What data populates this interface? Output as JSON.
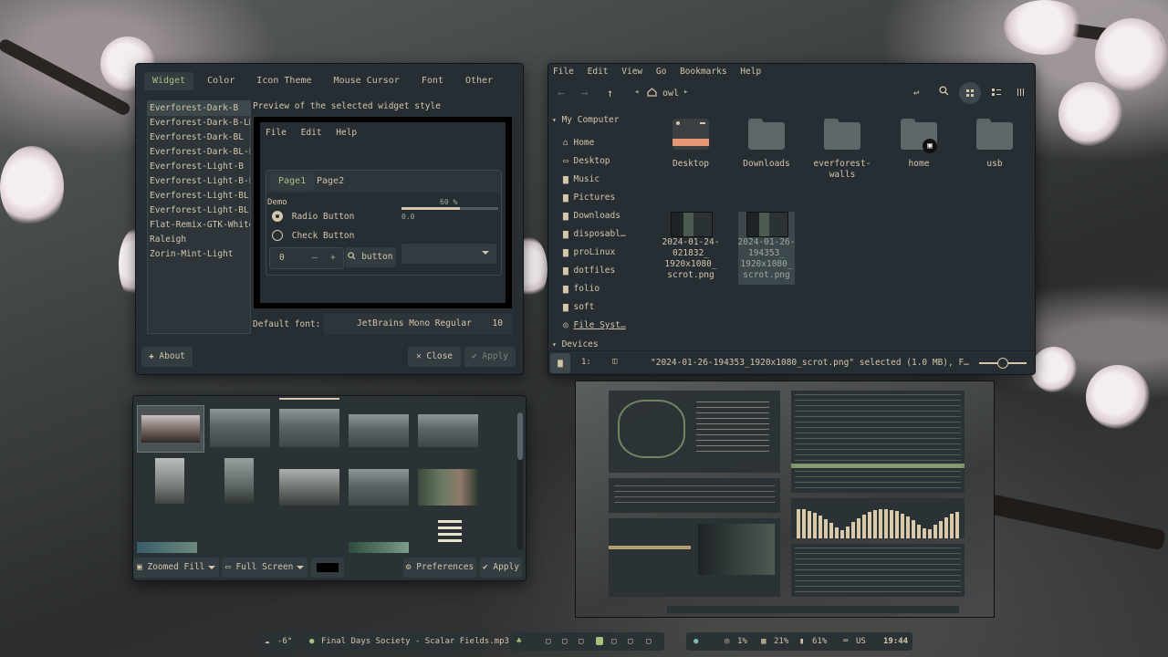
{
  "theme_window": {
    "tabs": [
      "Widget",
      "Color",
      "Icon Theme",
      "Mouse Cursor",
      "Font",
      "Other"
    ],
    "themes": [
      "Everforest-Dark-B",
      "Everforest-Dark-B-LB",
      "Everforest-Dark-BL",
      "Everforest-Dark-BL-LB",
      "Everforest-Light-B",
      "Everforest-Light-B-LB",
      "Everforest-Light-BL",
      "Everforest-Light-BL-LB",
      "Flat-Remix-GTK-White-Darkest",
      "Raleigh",
      "Zorin-Mint-Light"
    ],
    "preview_label": "Preview of the selected widget style",
    "preview_menu": [
      "File",
      "Edit",
      "Help"
    ],
    "preview_tabs": [
      "Page1",
      "Page2"
    ],
    "demo_label": "Demo",
    "radio_label": "Radio Button",
    "check_label": "Check Button",
    "progress_label": "60 %",
    "progress_value": 0.6,
    "scale_value": "0.0",
    "spin_value": "0",
    "button_label": "button",
    "default_font_label": "Default font:",
    "font_name": "JetBrains Mono Regular",
    "font_size": "10",
    "about_label": "About",
    "close_label": "Close",
    "apply_label": "Apply"
  },
  "file_manager": {
    "menu": [
      "File",
      "Edit",
      "View",
      "Go",
      "Bookmarks",
      "Help"
    ],
    "location": "owl",
    "section_my_computer": "My Computer",
    "sidebar": [
      "Home",
      "Desktop",
      "Music",
      "Pictures",
      "Downloads",
      "disposabl…",
      "proLinux",
      "dotfiles",
      "folio",
      "soft",
      "File Syst…"
    ],
    "section_devices": "Devices",
    "items_row1": [
      "Desktop",
      "Downloads",
      "everforest-walls",
      "home",
      "usb"
    ],
    "file1_label": "2024-01-24-021832_1920x1080_scrot.png",
    "file2_label": "2024-01-26-194353_1920x1080_scrot.png",
    "file1_lines": [
      "2024-01-24-",
      "021832_",
      "1920x1080_",
      "scrot.png"
    ],
    "file2_lines": [
      "2024-01-26-",
      "194353_",
      "1920x1080_",
      "scrot.png"
    ],
    "status": "\"2024-01-26-194353_1920x1080_scrot.png\" selected (1.0 MB), F…",
    "status_btn2": "1:"
  },
  "wallpaper_window": {
    "zoom_option": "Zoomed Fill",
    "screen_option": "Full Screen",
    "preferences_label": "Preferences",
    "apply_label": "Apply"
  },
  "taskbar": {
    "weather": "-6°",
    "music": "Final Days Society - Scalar Fields.mp3",
    "cpu": "1%",
    "memory": "21%",
    "battery": "61%",
    "keyboard": "US",
    "time": "19:44"
  },
  "colors": {
    "window_bg": "#272e33",
    "accent": "#a7c080",
    "text": "#d3c6aa"
  }
}
